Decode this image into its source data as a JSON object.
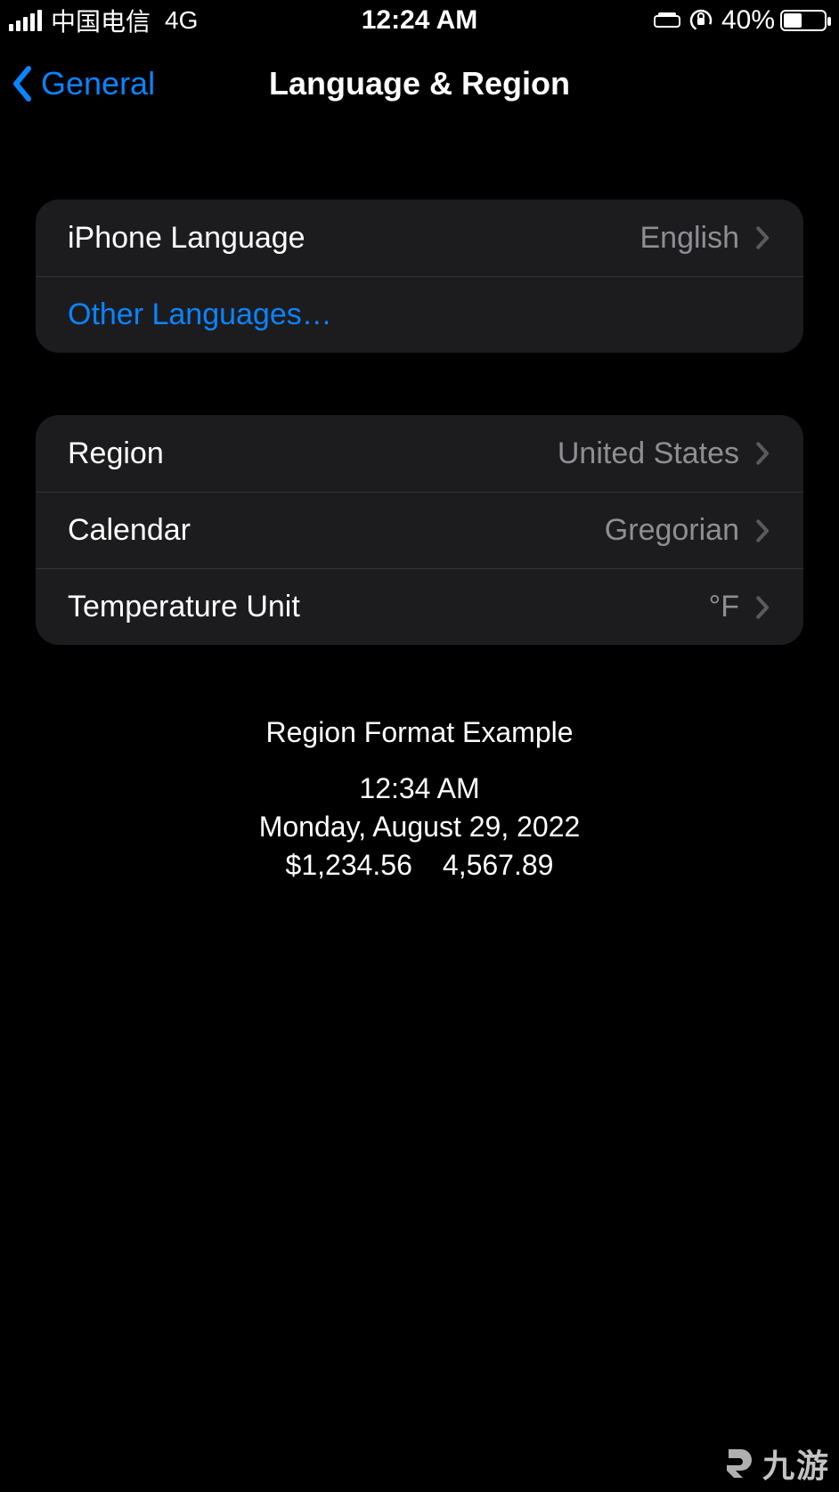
{
  "status": {
    "carrier": "中国电信",
    "network": "4G",
    "time": "12:24 AM",
    "battery_pct": "40%"
  },
  "nav": {
    "back_label": "General",
    "title": "Language & Region"
  },
  "group1": {
    "iphone_language_label": "iPhone Language",
    "iphone_language_value": "English",
    "other_languages_label": "Other Languages…"
  },
  "group2": {
    "region_label": "Region",
    "region_value": "United States",
    "calendar_label": "Calendar",
    "calendar_value": "Gregorian",
    "temp_label": "Temperature Unit",
    "temp_value": "°F"
  },
  "footer": {
    "title": "Region Format Example",
    "time": "12:34 AM",
    "date": "Monday, August 29, 2022",
    "currency": "$1,234.56",
    "number": "4,567.89"
  },
  "watermark": {
    "text": "九游"
  }
}
